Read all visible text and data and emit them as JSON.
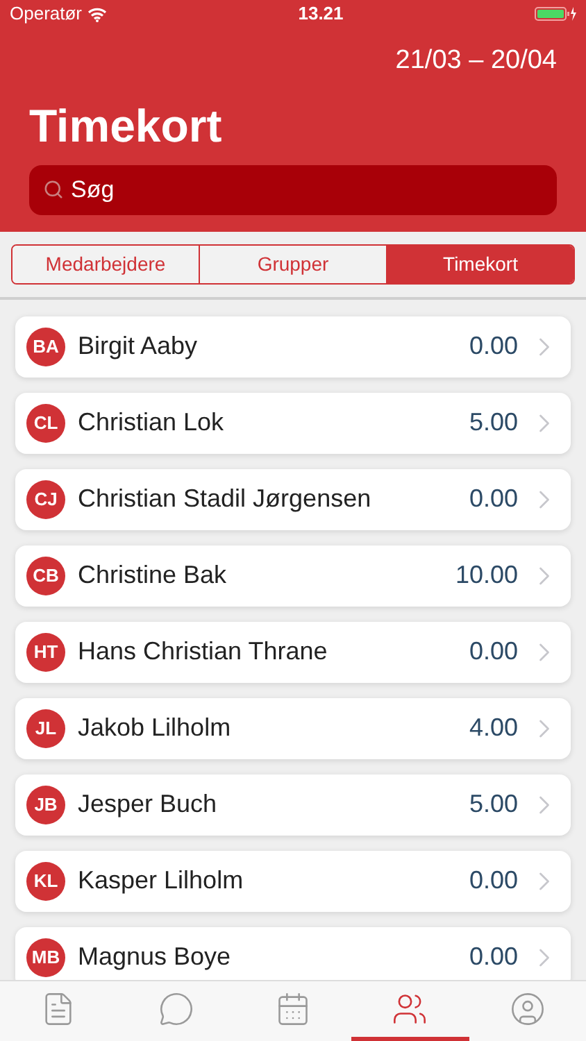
{
  "status_bar": {
    "carrier": "Operatør",
    "time": "13.21"
  },
  "header": {
    "period": "21/03 – 20/04",
    "title": "Timekort",
    "search": {
      "placeholder": "Søg"
    }
  },
  "segments": [
    {
      "label": "Medarbejdere",
      "selected": false
    },
    {
      "label": "Grupper",
      "selected": false
    },
    {
      "label": "Timekort",
      "selected": true
    }
  ],
  "employees": [
    {
      "initials": "BA",
      "name": "Birgit Aaby",
      "hours": "0.00"
    },
    {
      "initials": "CL",
      "name": "Christian Lok",
      "hours": "5.00"
    },
    {
      "initials": "CJ",
      "name": "Christian Stadil Jørgensen",
      "hours": "0.00"
    },
    {
      "initials": "CB",
      "name": "Christine Bak",
      "hours": "10.00"
    },
    {
      "initials": "HT",
      "name": "Hans Christian Thrane",
      "hours": "0.00"
    },
    {
      "initials": "JL",
      "name": "Jakob Lilholm",
      "hours": "4.00"
    },
    {
      "initials": "JB",
      "name": "Jesper Buch",
      "hours": "5.00"
    },
    {
      "initials": "KL",
      "name": "Kasper Lilholm",
      "hours": "0.00"
    },
    {
      "initials": "MB",
      "name": "Magnus Boye",
      "hours": "0.00"
    }
  ],
  "tab_bar": [
    {
      "kind": "document",
      "selected": false
    },
    {
      "kind": "chat",
      "selected": false
    },
    {
      "kind": "calendar",
      "selected": false
    },
    {
      "kind": "people",
      "selected": true
    },
    {
      "kind": "profile",
      "selected": false
    }
  ]
}
